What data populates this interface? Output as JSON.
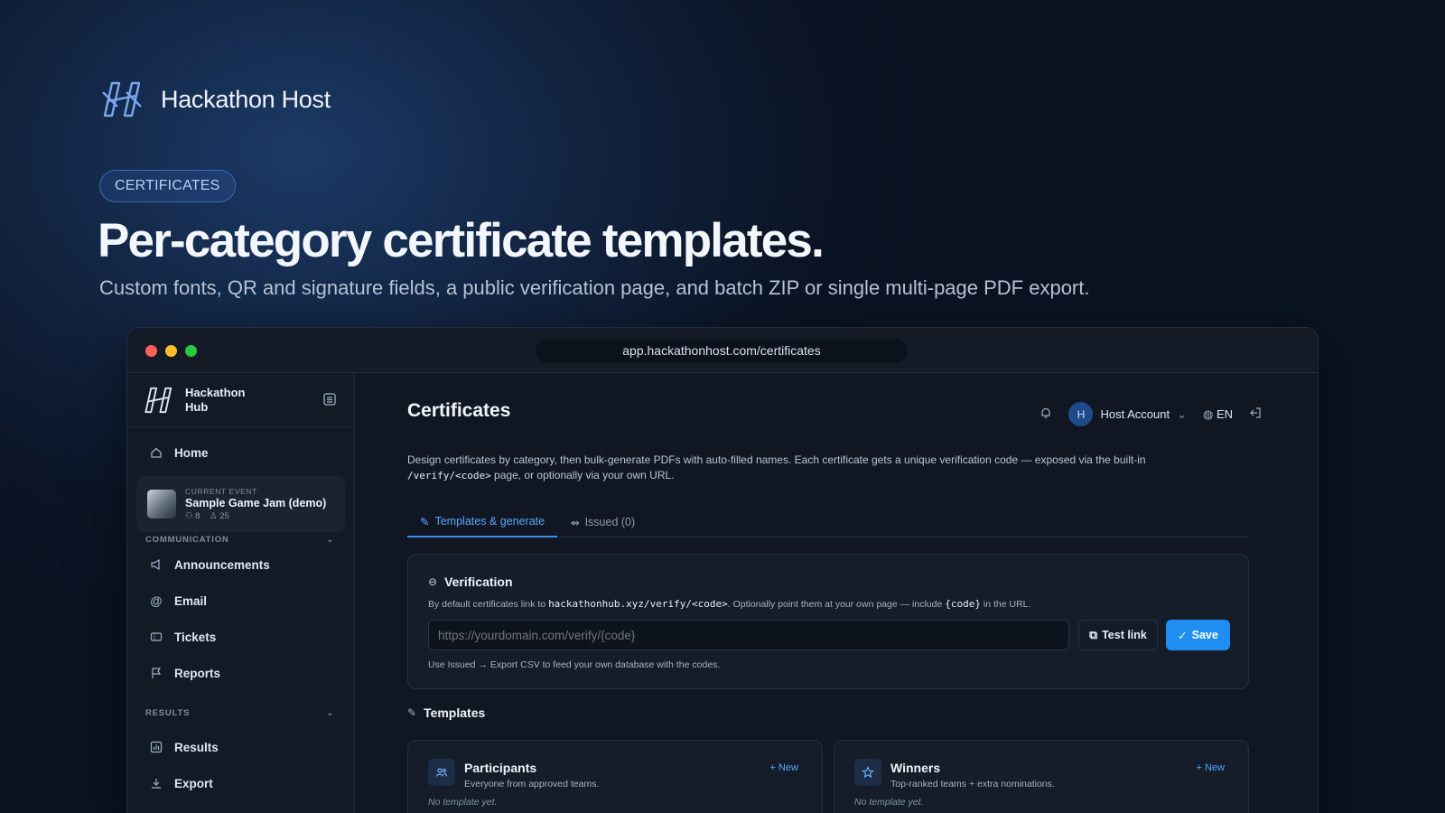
{
  "hero": {
    "brand_name": "Hackathon Host",
    "pill": "CERTIFICATES",
    "headline": "Per-category certificate templates.",
    "subheadline": "Custom fonts, QR and signature fields, a public verification page, and batch ZIP or single multi-page PDF export."
  },
  "browser": {
    "url": "app.hackathonhost.com/certificates"
  },
  "sidebar": {
    "brand_line1": "Hackathon",
    "brand_line2": "Hub",
    "home": "Home",
    "event": {
      "label": "CURRENT EVENT",
      "title": "Sample Game Jam (demo)",
      "teams": "8",
      "people": "25"
    },
    "section_communication": "COMMUNICATION",
    "communication_items": [
      "Announcements",
      "Email",
      "Tickets",
      "Reports"
    ],
    "section_results": "RESULTS",
    "results_items": [
      "Results",
      "Export"
    ]
  },
  "main": {
    "title": "Certificates",
    "account": {
      "initial": "H",
      "name": "Host Account",
      "lang": "EN"
    },
    "description_part1": "Design certificates by category, then bulk-generate PDFs with auto-filled names. Each certificate gets a unique verification code — exposed via the built-in",
    "description_code": "/verify/<code>",
    "description_part2": " page, or optionally via your own URL.",
    "tabs": [
      "Templates & generate",
      "Issued (0)"
    ],
    "verification": {
      "title": "Verification",
      "note_part1": "By default certificates link to ",
      "note_code1": "hackathonhub.xyz/verify/<code>",
      "note_part2": ". Optionally point them at your own page — include ",
      "note_code2": "{code}",
      "note_part3": " in the URL.",
      "placeholder": "https://yourdomain.com/verify/{code}",
      "test_label": "Test link",
      "save_label": "Save",
      "footer": "Use Issued → Export CSV to feed your own database with the codes."
    },
    "templates": {
      "heading": "Templates",
      "cards": [
        {
          "name": "Participants",
          "sub": "Everyone from approved teams.",
          "empty": "No template yet.",
          "new": "+ New"
        },
        {
          "name": "Winners",
          "sub": "Top-ranked teams + extra nominations.",
          "empty": "No template yet.",
          "new": "+ New"
        }
      ]
    }
  },
  "colors": {
    "accent": "#1f8ef0",
    "background": "#0b1526"
  }
}
